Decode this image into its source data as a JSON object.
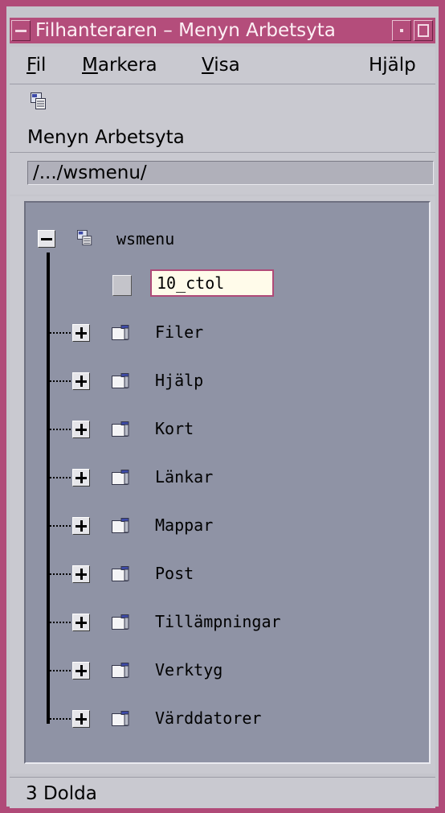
{
  "window": {
    "title": "Filhanteraren – Menyn Arbetsyta"
  },
  "menubar": {
    "file": {
      "mnemonic": "F",
      "rest": "il"
    },
    "select": {
      "mnemonic": "M",
      "rest": "arkera"
    },
    "view": {
      "mnemonic": "V",
      "rest": "isa"
    },
    "help": "Hjälp"
  },
  "toolbar": {
    "label": "Menyn Arbetsyta",
    "icon": "workspace-menu-icon"
  },
  "path": {
    "value": "/.../wsmenu/"
  },
  "tree": {
    "root": {
      "label": "wsmenu",
      "expanded": true
    },
    "edit_item": {
      "value": "10_ctol"
    },
    "folders": [
      {
        "label": "Filer"
      },
      {
        "label": "Hjälp"
      },
      {
        "label": "Kort"
      },
      {
        "label": "Länkar"
      },
      {
        "label": "Mappar"
      },
      {
        "label": "Post"
      },
      {
        "label": "Tillämpningar"
      },
      {
        "label": "Verktyg"
      },
      {
        "label": "Värddatorer"
      }
    ]
  },
  "status": {
    "text": "3 Dolda"
  },
  "colors": {
    "titlebar": "#b44d7b",
    "panel": "#8f93a5",
    "chrome": "#c9c9d0"
  }
}
